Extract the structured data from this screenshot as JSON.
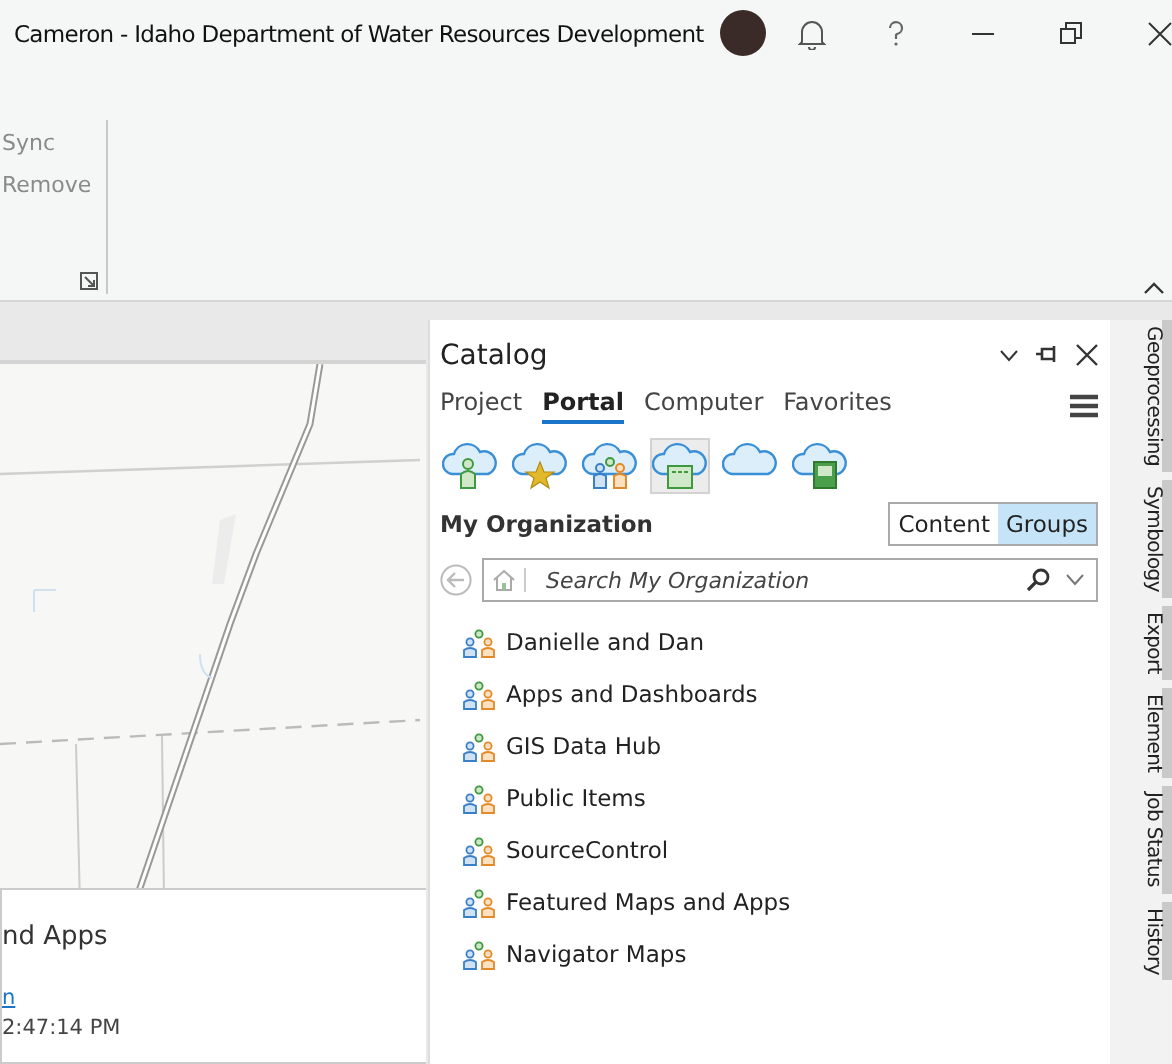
{
  "window": {
    "title": "Cameron - Idaho Department of Water Resources Development"
  },
  "ribbon": {
    "commands": [
      {
        "label": "Sync",
        "disabled": true
      },
      {
        "label": "Remove",
        "disabled": true
      }
    ]
  },
  "map_popup": {
    "title": "nd Apps",
    "link": "n",
    "time": "2:47:14 PM"
  },
  "catalog": {
    "title": "Catalog",
    "tabs": [
      {
        "label": "Project",
        "selected": false
      },
      {
        "label": "Portal",
        "selected": true
      },
      {
        "label": "Computer",
        "selected": false
      },
      {
        "label": "Favorites",
        "selected": false
      }
    ],
    "portal_buttons": [
      {
        "kind": "user",
        "selected": false
      },
      {
        "kind": "favorites",
        "selected": false
      },
      {
        "kind": "groups",
        "selected": false
      },
      {
        "kind": "organization",
        "selected": true
      },
      {
        "kind": "cloud",
        "selected": false
      },
      {
        "kind": "living-atlas",
        "selected": false
      }
    ],
    "section_title": "My Organization",
    "view_toggle": [
      {
        "label": "Content",
        "selected": false
      },
      {
        "label": "Groups",
        "selected": true
      }
    ],
    "search": {
      "placeholder": "Search My Organization"
    },
    "groups": [
      "Danielle and Dan",
      "Apps and Dashboards",
      "GIS Data Hub",
      "Public Items",
      "SourceControl",
      "Featured Maps and Apps",
      "Navigator Maps"
    ]
  },
  "side_tabs": [
    "Geoprocessing",
    "Symbology",
    "Export",
    "Element",
    "Job Status",
    "History"
  ]
}
